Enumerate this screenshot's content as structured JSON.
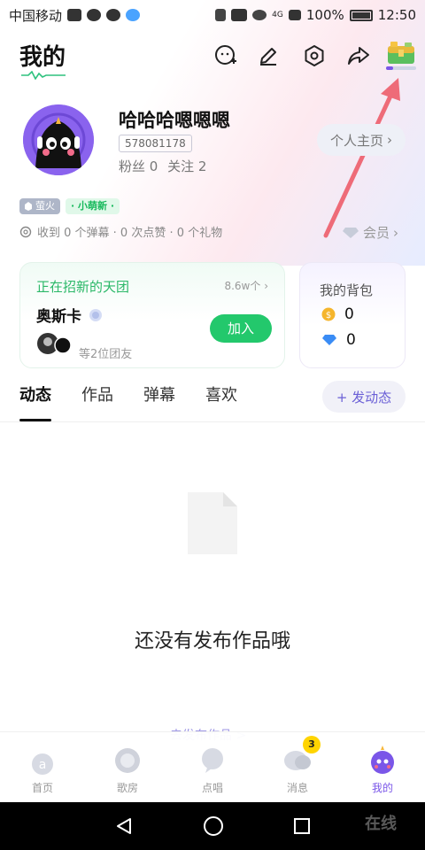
{
  "status_bar": {
    "carrier": "中国移动",
    "network": "4G",
    "battery": "100%",
    "time": "12:50"
  },
  "header": {
    "title": "我的",
    "icons": [
      "add-friend-icon",
      "edit-icon",
      "settings-icon",
      "share-icon",
      "treasure-chest-icon"
    ]
  },
  "profile": {
    "username": "哈哈哈嗯嗯嗯",
    "uid": "578081178",
    "fans_label": "粉丝",
    "fans": "0",
    "following_label": "关注",
    "following": "2",
    "homepage_label": "个人主页",
    "badges": [
      "萤火",
      "· 小萌新 ·"
    ],
    "received": "收到 0 个弹幕 · 0 次点赞 · 0 个礼物",
    "member_label": "会员"
  },
  "group_card": {
    "title": "正在招新的天团",
    "count": "8.6w个",
    "name": "奥斯卡",
    "members": "等2位团友",
    "join_label": "加入"
  },
  "bag_card": {
    "title": "我的背包",
    "coins": "0",
    "diamonds": "0"
  },
  "tabs": {
    "items": [
      "动态",
      "作品",
      "弹幕",
      "喜欢"
    ],
    "active": "动态",
    "post_label": "+ 发动态"
  },
  "empty_state": {
    "message": "还没有发布作品哦",
    "link": "去发布作品 >"
  },
  "bottom_nav": [
    {
      "label": "首页",
      "icon": "home-icon"
    },
    {
      "label": "歌房",
      "icon": "song-room-icon"
    },
    {
      "label": "点唱",
      "icon": "request-song-icon"
    },
    {
      "label": "消息",
      "icon": "message-icon",
      "badge": "3"
    },
    {
      "label": "我的",
      "icon": "my-profile-icon",
      "active": true
    }
  ],
  "watermark": "在线",
  "colors": {
    "accent_green": "#23c86c",
    "accent_purple": "#7a56e8",
    "arrow": "#ee6b78"
  }
}
